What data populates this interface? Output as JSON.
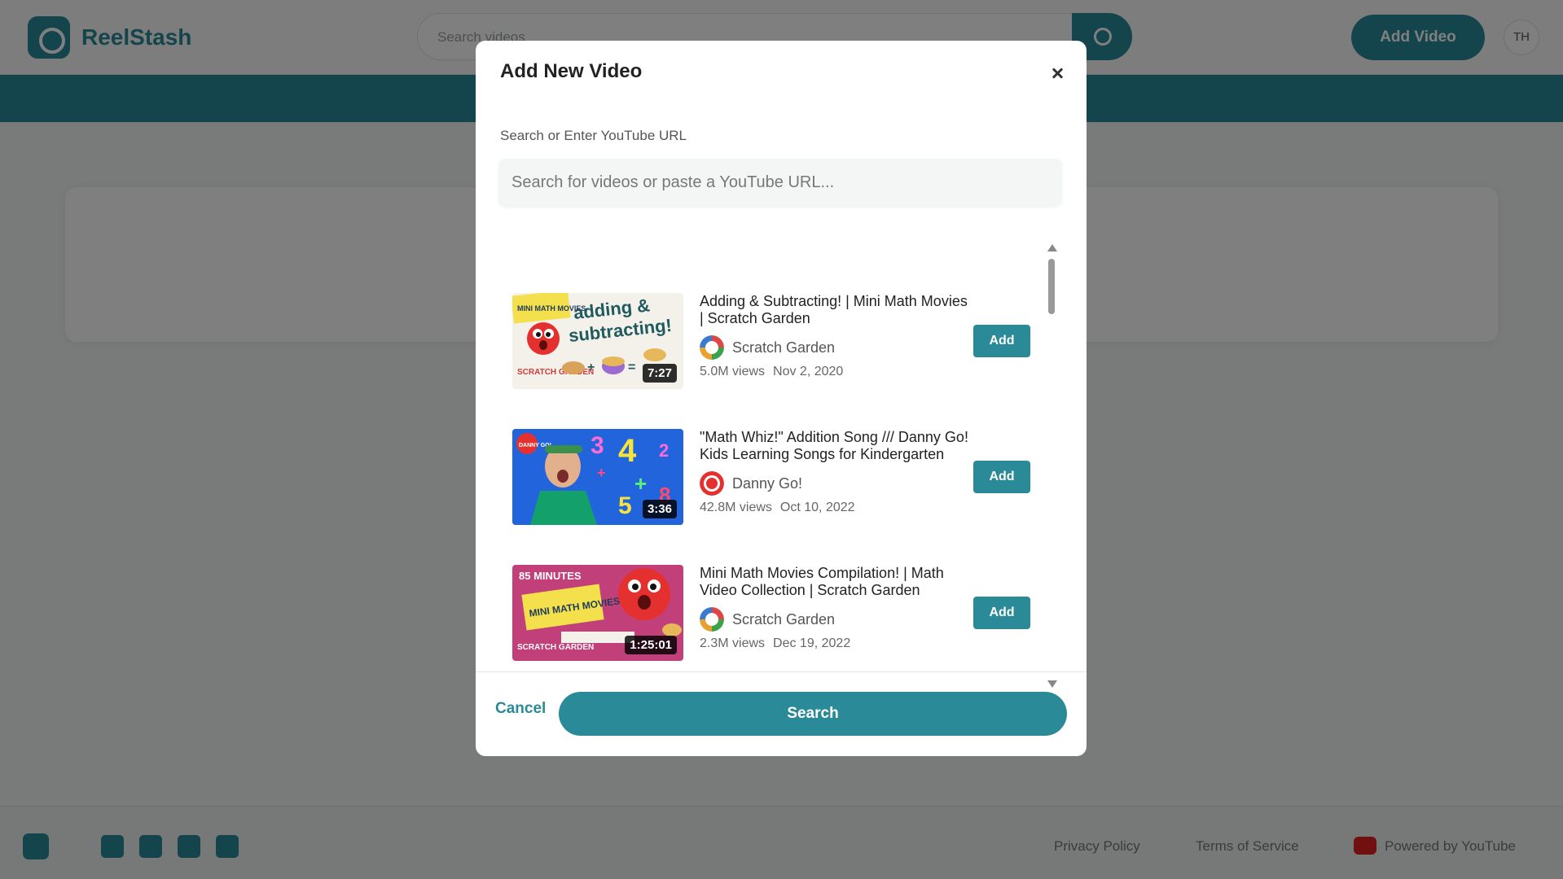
{
  "app": {
    "brand": "ReelStash",
    "search_placeholder": "Search videos",
    "add_video_label": "Add Video",
    "avatar_initials": "TH"
  },
  "footer": {
    "links": [
      "Privacy Policy",
      "Terms of Service"
    ],
    "powered_by": "Powered by YouTube"
  },
  "modal": {
    "title": "Add New Video",
    "field_label": "Search or Enter YouTube URL",
    "input_placeholder": "Search for videos or paste a YouTube URL...",
    "input_value": "",
    "cancel_label": "Cancel",
    "search_label": "Search",
    "results": [
      {
        "title": "Adding & Subtracting! | Mini Math Movies | Scratch Garden",
        "channel": "Scratch Garden",
        "views": "5.0M views",
        "date": "Nov 2, 2020",
        "duration": "7:27",
        "add_label": "Add"
      },
      {
        "title": "\"Math Whiz!\" Addition Song /// Danny Go! Kids Learning Songs for Kindergarten",
        "channel": "Danny Go!",
        "views": "42.8M views",
        "date": "Oct 10, 2022",
        "duration": "3:36",
        "add_label": "Add"
      },
      {
        "title": "Mini Math Movies Compilation! | Math Video Collection | Scratch Garden",
        "channel": "Scratch Garden",
        "views": "2.3M views",
        "date": "Dec 19, 2022",
        "duration": "1:25:01",
        "add_label": "Add"
      }
    ],
    "thumb_text": {
      "t1_badge": "MINI MATH MOVIES",
      "t1_line1": "adding &",
      "t1_line2": "subtracting!",
      "t1_brand": "SCRATCH GARDEN",
      "t2_badge": "DANNY GO!",
      "t3_top": "85 MINUTES",
      "t3_badge": "MINI MATH MOVIES",
      "t3_brand": "SCRATCH GARDEN"
    }
  },
  "colors": {
    "accent": "#2b8a98",
    "overlay": "rgba(0,0,0,0.5)"
  }
}
